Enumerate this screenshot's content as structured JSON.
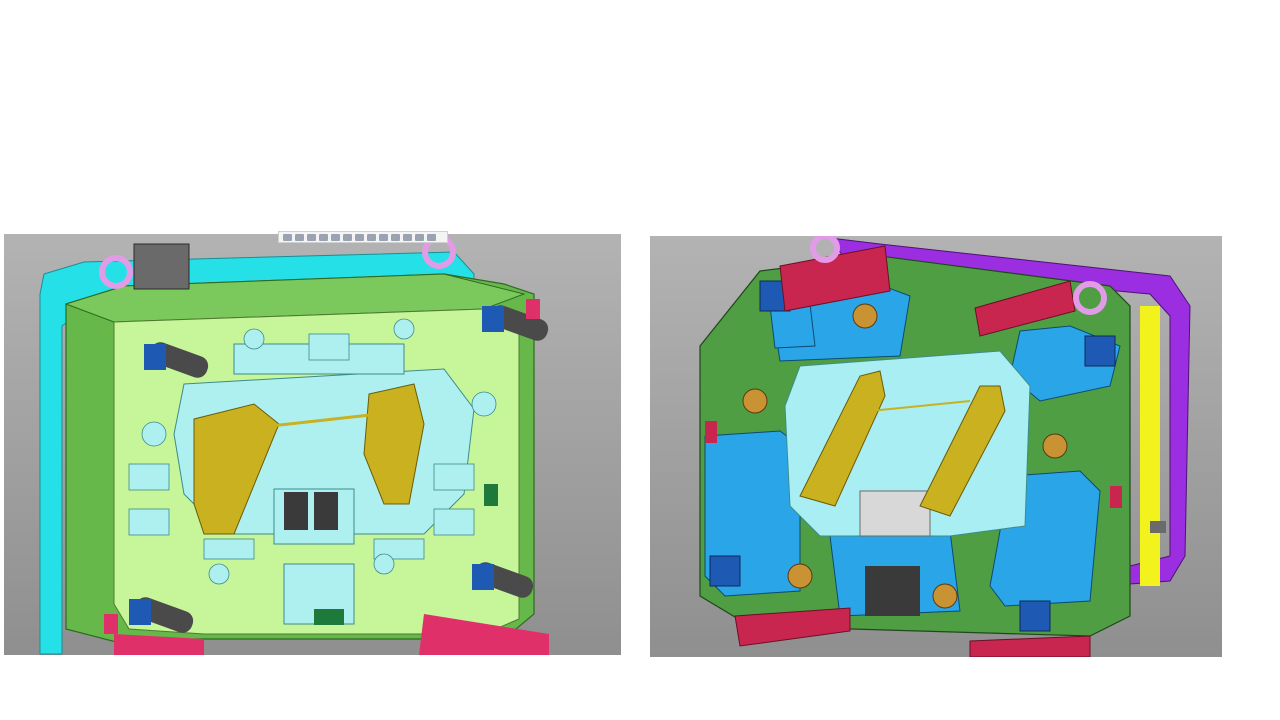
{
  "slide": {
    "background": "#ffffff"
  },
  "left_render": {
    "viewport_background": "#a9a9a9",
    "colors": {
      "plate": "#66b84a",
      "core": "#c7f59a",
      "insert": "#aef0f0",
      "frame": "#26e0e8",
      "part": "#c9b120",
      "lift_ring": "#e29be6",
      "pin": "#4a4a4a",
      "clamp": "#e0306a"
    }
  },
  "right_render": {
    "viewport_background": "#a9a9a9",
    "colors": {
      "plate": "#4f9e44",
      "slide_block": "#2aa6e8",
      "insert": "#a9eef2",
      "frame": "#9b2ee0",
      "clamp": "#c8254f",
      "part": "#c9b120",
      "cylinder": "#c99334",
      "lift_ring": "#e29be6",
      "accent": "#f2f21c"
    }
  }
}
